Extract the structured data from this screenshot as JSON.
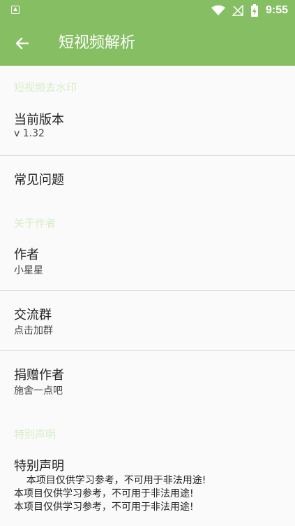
{
  "status_bar": {
    "time": "9:55"
  },
  "app_bar": {
    "title": "短视频解析"
  },
  "sections": {
    "watermark": {
      "header": "短视频去水印",
      "version_title": "当前版本",
      "version_value": "v 1.32",
      "faq_title": "常见问题"
    },
    "author": {
      "header": "关于作者",
      "author_title": "作者",
      "author_value": "小星星",
      "group_title": "交流群",
      "group_value": "点击加群",
      "donate_title": "捐赠作者",
      "donate_value": "施舍一点吧"
    },
    "statement": {
      "header": "特别声明",
      "title": "特别声明",
      "line1": "    本项目仅供学习参考，不可用于非法用途!",
      "line2": "本项目仅供学习参考，不可用于非法用途!",
      "line3": "本项目仅供学习参考，不可用于非法用途!"
    }
  }
}
